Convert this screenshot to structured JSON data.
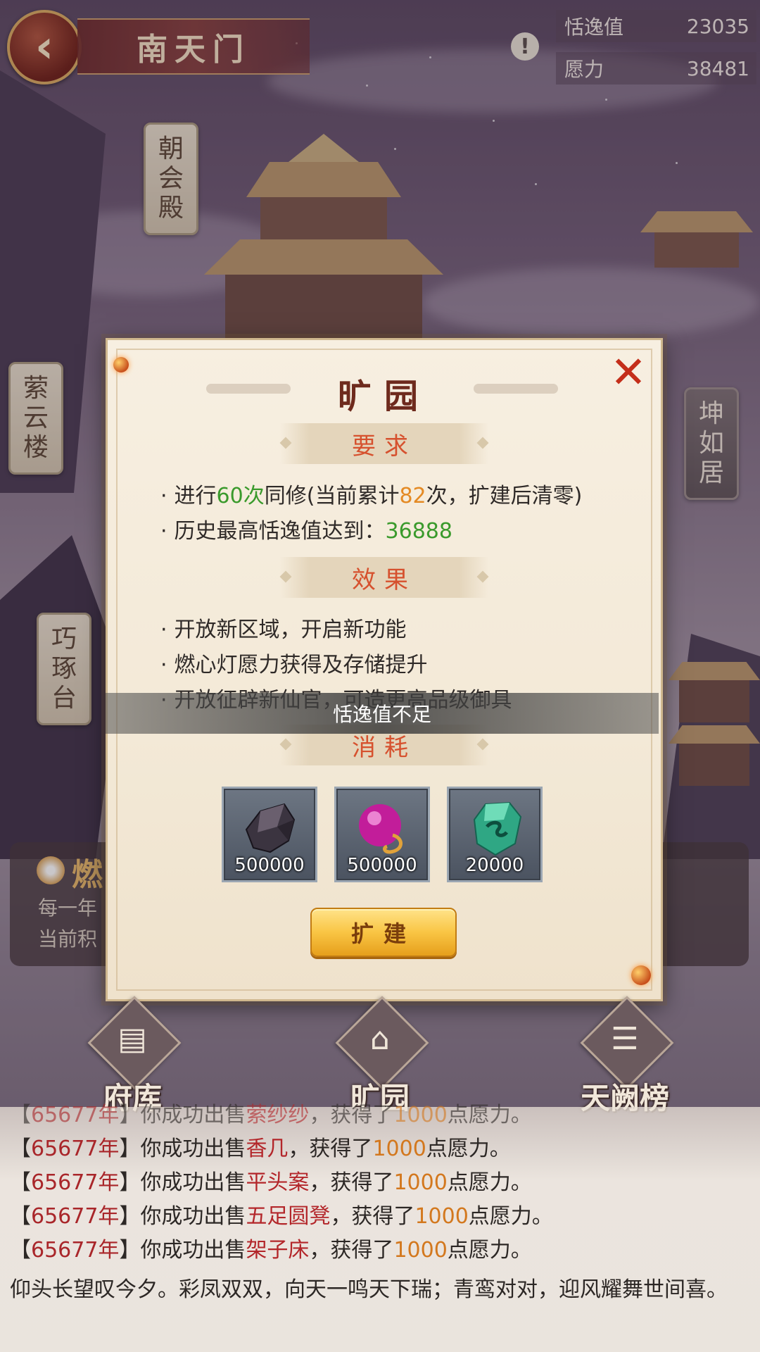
{
  "header": {
    "back_glyph": "‹",
    "title": "南天门",
    "warn_glyph": "!",
    "stats": [
      {
        "label": "恬逸值",
        "value": "23035"
      },
      {
        "label": "愿力",
        "value": "38481"
      }
    ]
  },
  "buildings": {
    "chaohui": "朝会殿",
    "ziyun": "萦云楼",
    "qiaozhuo": "巧琢台",
    "kunru": "坤如居"
  },
  "background_panel": {
    "title": "燃",
    "line1": "每一年",
    "line2": "当前积"
  },
  "popup": {
    "title": "旷园",
    "close_glyph": "✕",
    "requirements": {
      "heading": "要求",
      "line1": {
        "bullet": "·",
        "a": "进行",
        "b": "60次",
        "c": "同修(当前累计",
        "d": "82",
        "e": "次，扩建后清零)"
      },
      "line2": {
        "bullet": "·",
        "a": "历史最高恬逸值达到：",
        "b": "36888"
      }
    },
    "effects": {
      "heading": "效果",
      "items": [
        {
          "bullet": "·",
          "text": "开放新区域，开启新功能"
        },
        {
          "bullet": "·",
          "text": "燃心灯愿力获得及存储提升"
        },
        {
          "bullet": "·",
          "text": "开放征辟新仙官，可造更高品级御具"
        }
      ]
    },
    "cost": {
      "heading": "消耗",
      "items": [
        {
          "icon": "dark-ore-icon",
          "qty": "500000"
        },
        {
          "icon": "purple-orb-icon",
          "qty": "500000"
        },
        {
          "icon": "jade-stone-icon",
          "qty": "20000"
        }
      ]
    },
    "expand_button": "扩建"
  },
  "toast": "恬逸值不足",
  "nav": {
    "items": [
      {
        "label": "府库",
        "glyph": "▤"
      },
      {
        "label": "旷园",
        "glyph": "⌂"
      },
      {
        "label": "天阙榜",
        "glyph": "☰"
      }
    ]
  },
  "log": {
    "entries": [
      {
        "lb": "【",
        "year": "65677年",
        "rb": "】",
        "a": "你成功出售",
        "item": "萦纱纱",
        "b": "，获得了",
        "num": "1000",
        "c": "点愿力。"
      },
      {
        "lb": "【",
        "year": "65677年",
        "rb": "】",
        "a": "你成功出售",
        "item": "香几",
        "b": "，获得了",
        "num": "1000",
        "c": "点愿力。"
      },
      {
        "lb": "【",
        "year": "65677年",
        "rb": "】",
        "a": "你成功出售",
        "item": "平头案",
        "b": "，获得了",
        "num": "1000",
        "c": "点愿力。"
      },
      {
        "lb": "【",
        "year": "65677年",
        "rb": "】",
        "a": "你成功出售",
        "item": "五足圆凳",
        "b": "，获得了",
        "num": "1000",
        "c": "点愿力。"
      },
      {
        "lb": "【",
        "year": "65677年",
        "rb": "】",
        "a": "你成功出售",
        "item": "架子床",
        "b": "，获得了",
        "num": "1000",
        "c": "点愿力。"
      }
    ],
    "poem": "仰头长望叹今夕。彩凤双双，向天一鸣天下瑞；青鸾对对，迎风耀舞世间喜。"
  },
  "colors": {
    "accent_red": "#c42e1a",
    "green": "#3a9a2c",
    "orange": "#e48a24",
    "gold_button": "#f9c544"
  }
}
